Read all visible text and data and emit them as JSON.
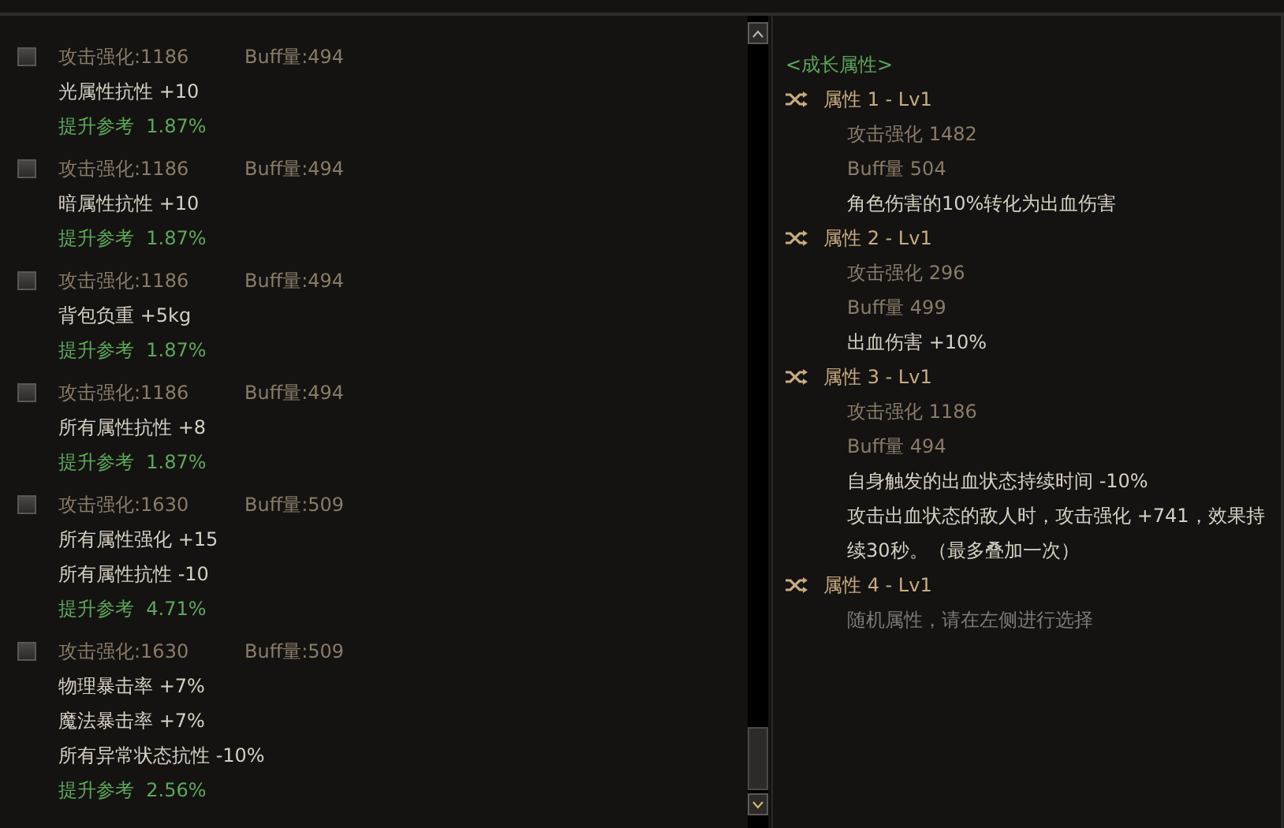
{
  "options": [
    {
      "checked": false,
      "attack": "攻击强化:1186",
      "buff": "Buff量:494",
      "effects": [
        "光属性抗性 +10"
      ],
      "reference": "提升参考  1.87%"
    },
    {
      "checked": false,
      "attack": "攻击强化:1186",
      "buff": "Buff量:494",
      "effects": [
        "暗属性抗性 +10"
      ],
      "reference": "提升参考  1.87%"
    },
    {
      "checked": false,
      "attack": "攻击强化:1186",
      "buff": "Buff量:494",
      "effects": [
        "背包负重 +5kg"
      ],
      "reference": "提升参考  1.87%"
    },
    {
      "checked": false,
      "attack": "攻击强化:1186",
      "buff": "Buff量:494",
      "effects": [
        "所有属性抗性 +8"
      ],
      "reference": "提升参考  1.87%"
    },
    {
      "checked": false,
      "attack": "攻击强化:1630",
      "buff": "Buff量:509",
      "effects": [
        "所有属性强化 +15",
        "所有属性抗性 -10"
      ],
      "reference": "提升参考  4.71%"
    },
    {
      "checked": false,
      "attack": "攻击强化:1630",
      "buff": "Buff量:509",
      "effects": [
        "物理暴击率 +7%",
        "魔法暴击率 +7%",
        "所有异常状态抗性 -10%"
      ],
      "reference": "提升参考  2.56%"
    }
  ],
  "growth": {
    "title": "<成长属性>",
    "attributes": [
      {
        "header": "属性 1 - Lv1",
        "lines": [
          {
            "kind": "stat",
            "text": "攻击强化 1482"
          },
          {
            "kind": "stat",
            "text": "Buff量 504"
          },
          {
            "kind": "effect",
            "text": "角色伤害的10%转化为出血伤害"
          }
        ]
      },
      {
        "header": "属性 2 - Lv1",
        "lines": [
          {
            "kind": "stat",
            "text": "攻击强化 296"
          },
          {
            "kind": "stat",
            "text": "Buff量 499"
          },
          {
            "kind": "effect",
            "text": "出血伤害 +10%"
          }
        ]
      },
      {
        "header": "属性 3 - Lv1",
        "lines": [
          {
            "kind": "stat",
            "text": "攻击强化 1186"
          },
          {
            "kind": "stat",
            "text": "Buff量 494"
          },
          {
            "kind": "effect",
            "text": "自身触发的出血状态持续时间 -10%"
          },
          {
            "kind": "effect",
            "text": "攻击出血状态的敌人时，攻击强化 +741，效果持续30秒。（最多叠加一次）"
          }
        ]
      },
      {
        "header": "属性 4 - Lv1",
        "lines": [
          {
            "kind": "hint",
            "text": "随机属性，请在左侧进行选择"
          }
        ]
      }
    ]
  }
}
